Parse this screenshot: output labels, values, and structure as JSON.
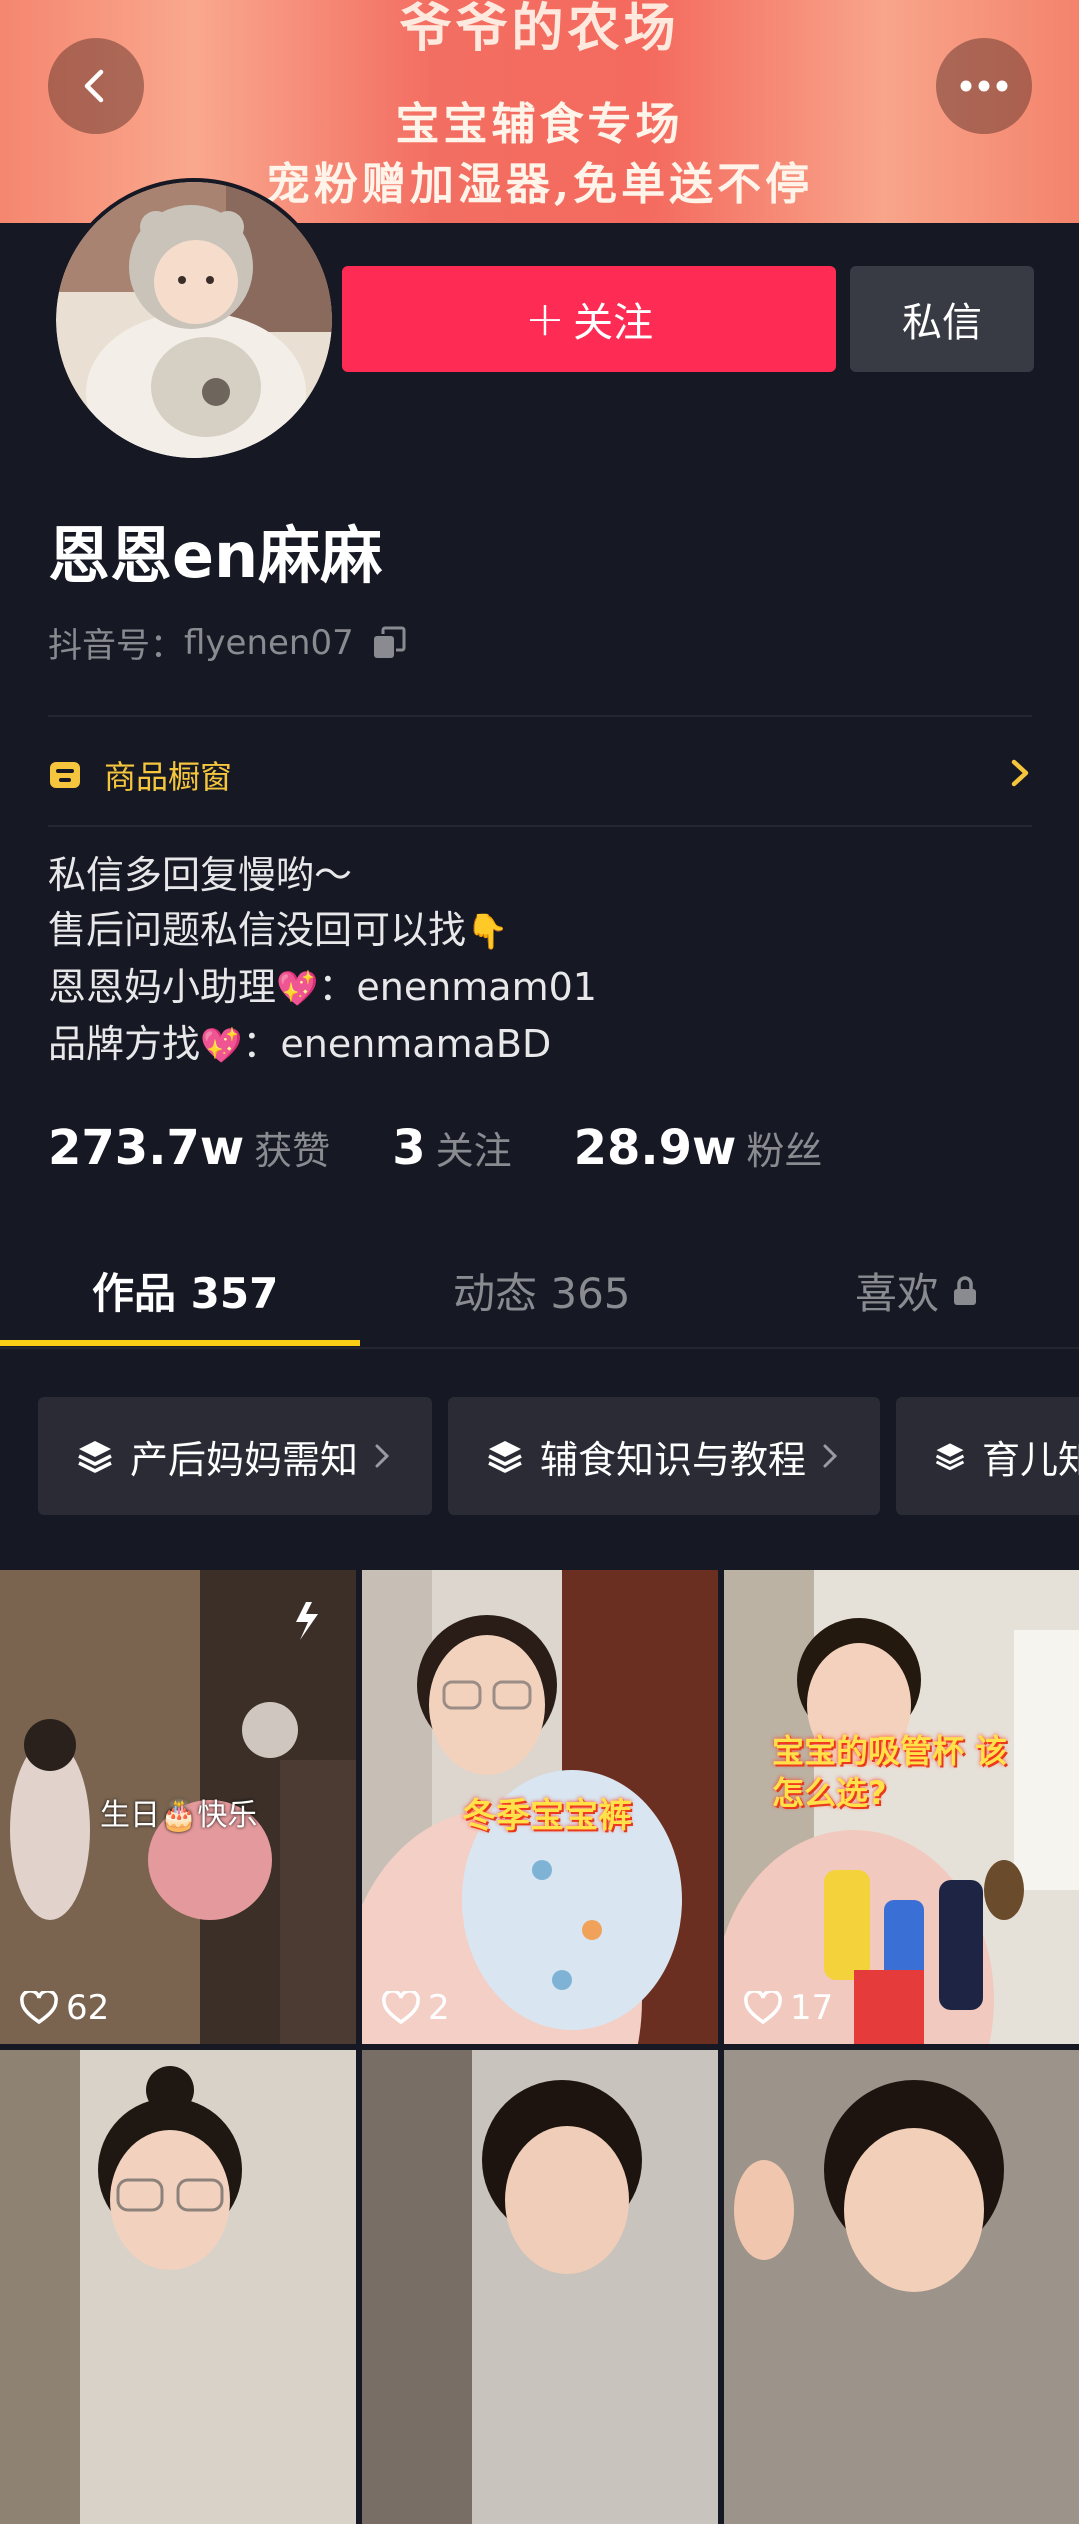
{
  "banner": {
    "line1": "爷爷的农场",
    "line2": "宝宝辅食专场",
    "line3": "宠粉赠加湿器,免单送不停"
  },
  "header": {
    "back_icon": "chevron-left-icon",
    "more_icon": "ellipsis-icon"
  },
  "profile": {
    "name": "恩恩en麻麻",
    "douyin_id_label": "抖音号：",
    "douyin_id": "flyenen07",
    "follow_label": "关注",
    "message_label": "私信"
  },
  "shop": {
    "label": "商品橱窗"
  },
  "bio": {
    "line1": "私信多回复慢哟～",
    "line2_text": "售后问题私信没回可以找",
    "line2_emoji": "👇",
    "line3_prefix": "恩恩妈小助理",
    "line3_emoji": "💖",
    "line3_suffix": "：enenmam01",
    "line4_prefix": "品牌方找",
    "line4_emoji": "💖",
    "line4_suffix": "：enenmamaBD"
  },
  "stats": {
    "likes_value": "273.7w",
    "likes_label": "获赞",
    "following_value": "3",
    "following_label": "关注",
    "fans_value": "28.9w",
    "fans_label": "粉丝"
  },
  "tabs": {
    "works": "作品 357",
    "activity": "动态 365",
    "likes": "喜欢"
  },
  "collections": [
    {
      "label": "产后妈妈需知"
    },
    {
      "label": "辅食知识与教程"
    },
    {
      "label": "育儿知"
    }
  ],
  "videos": [
    {
      "likes": "62",
      "caption": "生日🎂快乐",
      "sticker": ""
    },
    {
      "likes": "2",
      "caption": "",
      "sticker": "冬季宝宝裤"
    },
    {
      "likes": "17",
      "caption": "",
      "sticker": "宝宝的吸管杯 该怎么选?"
    },
    {
      "likes": "",
      "caption": "",
      "sticker": ""
    },
    {
      "likes": "",
      "caption": "",
      "sticker": ""
    },
    {
      "likes": "",
      "caption": "",
      "sticker": ""
    }
  ],
  "colors": {
    "background": "#161823",
    "follow_button": "#fe2c55",
    "tab_indicator": "#face15",
    "shop_accent": "#f5c63d"
  }
}
